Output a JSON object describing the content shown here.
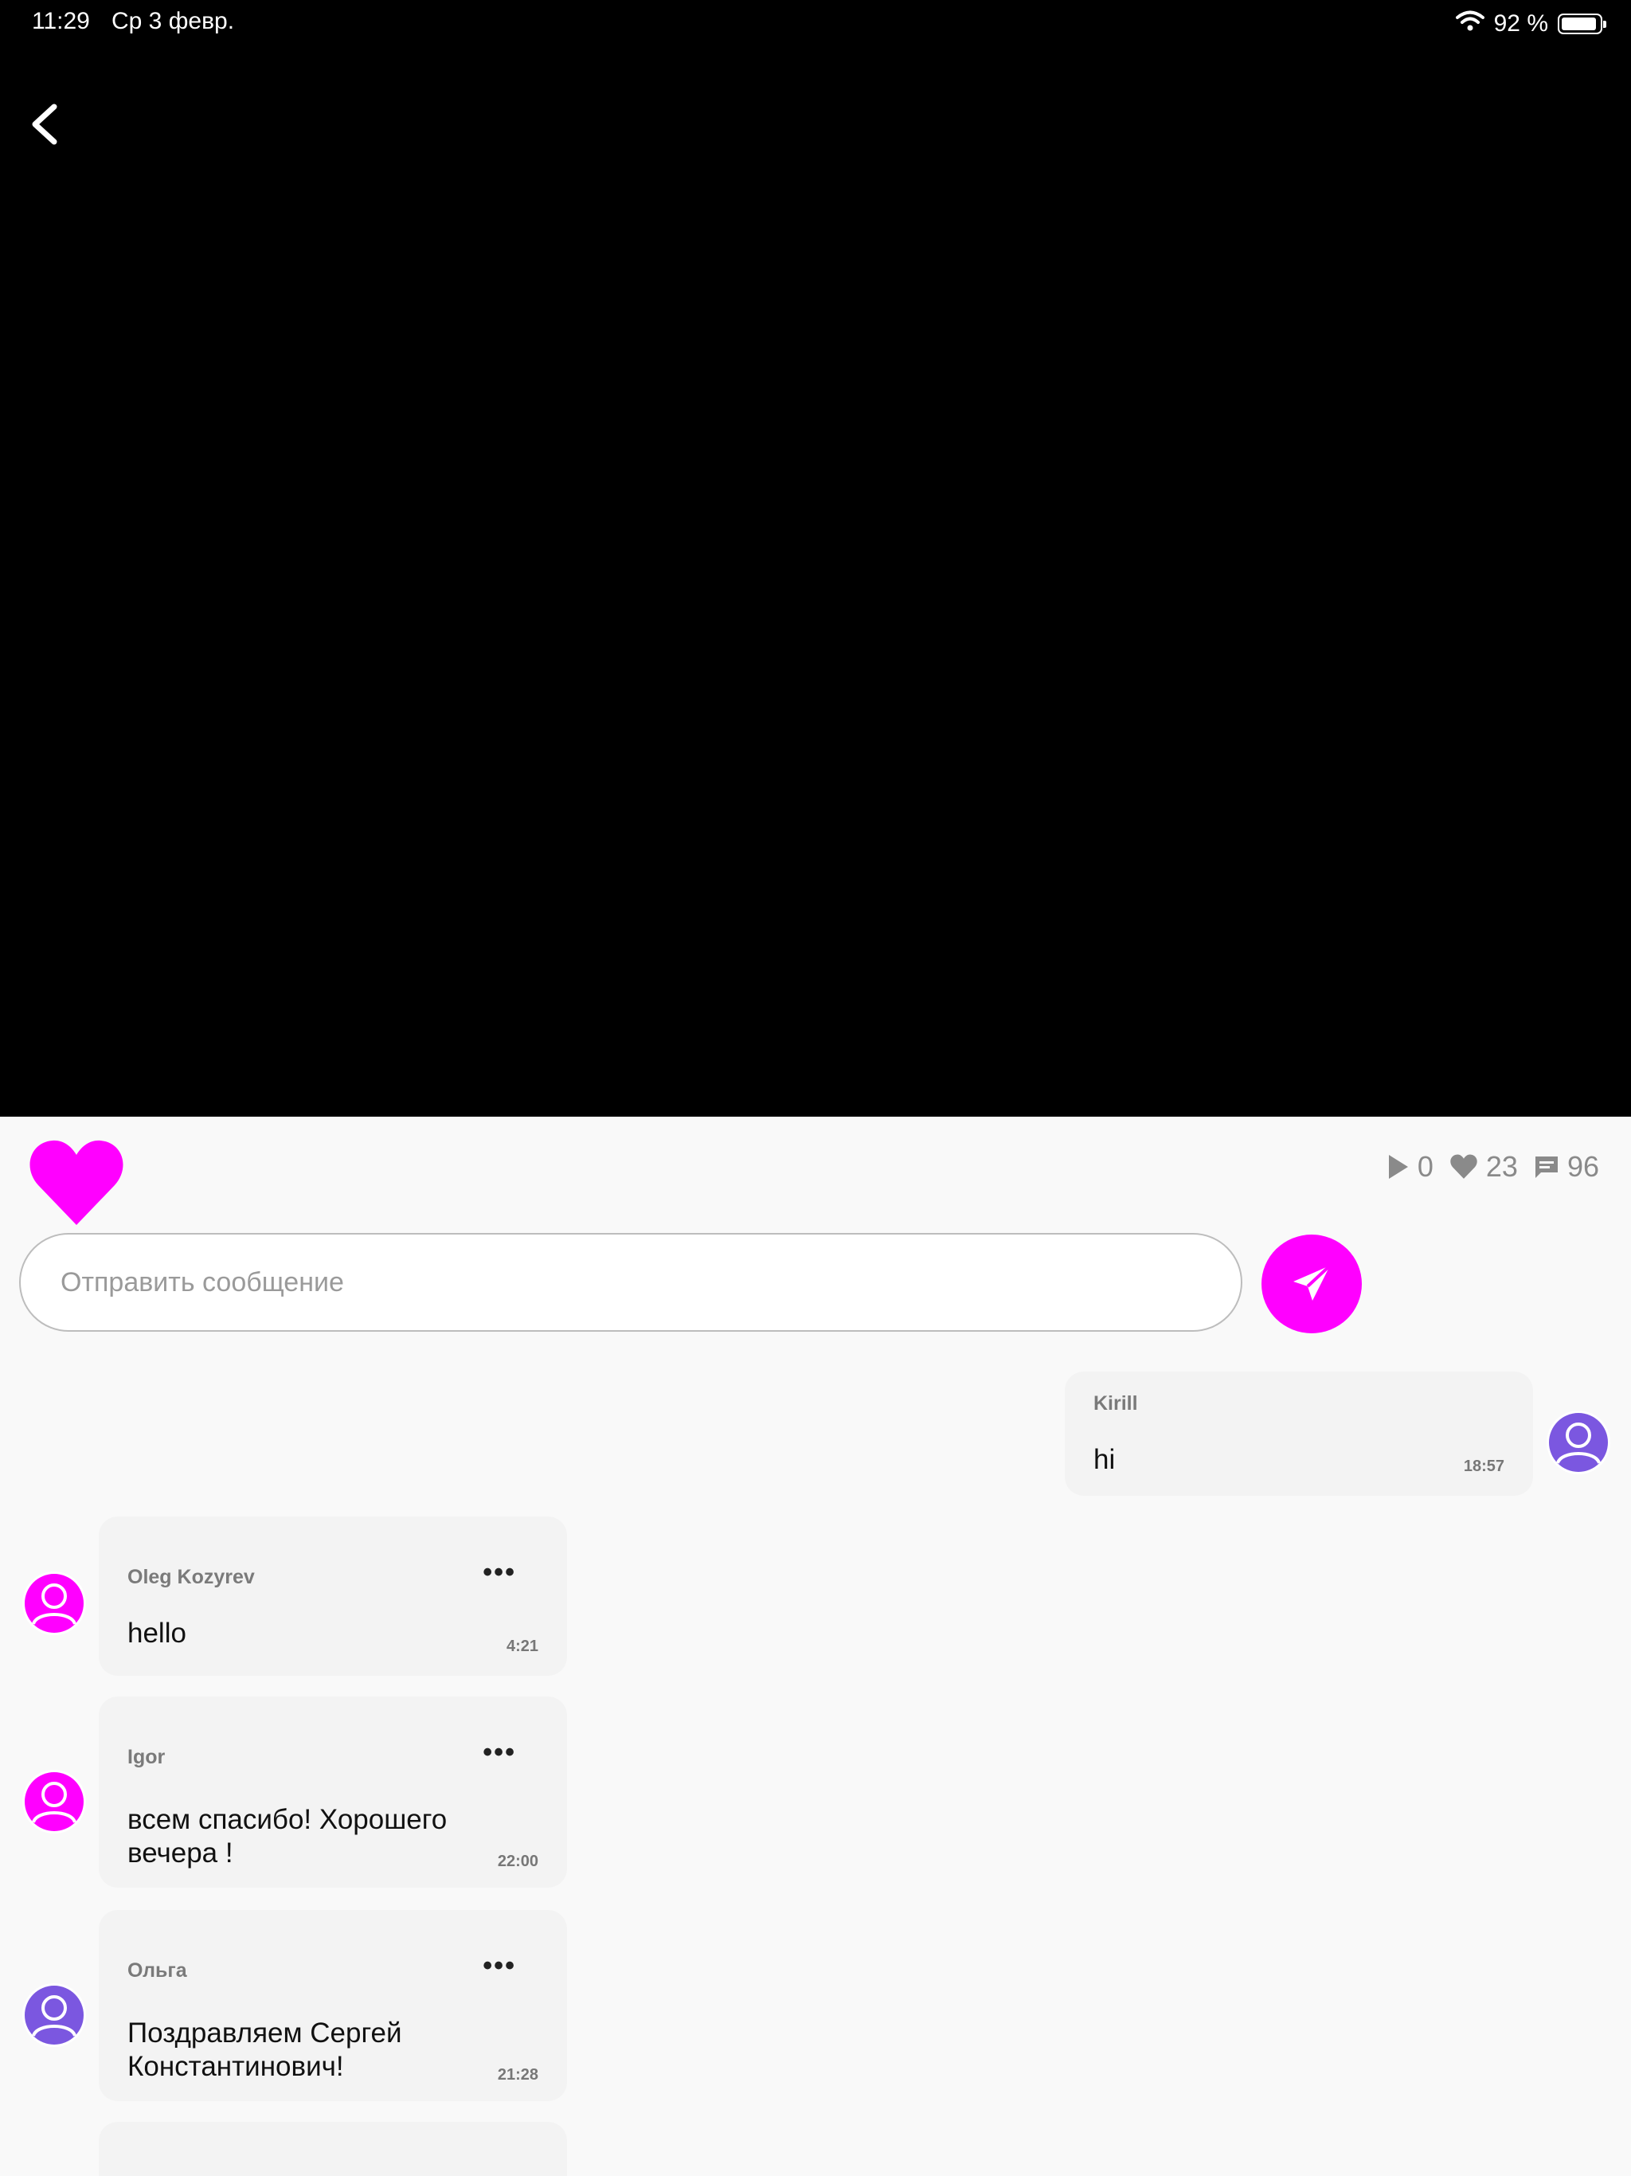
{
  "status_bar": {
    "time": "11:29",
    "date": "Ср 3 февр.",
    "battery": "92 %"
  },
  "stats": {
    "views": "0",
    "likes": "23",
    "comments": "96"
  },
  "composer": {
    "placeholder": "Отправить сообщение"
  },
  "colors": {
    "accent": "#ff00ff",
    "avatar_purple": "#7b57e0"
  },
  "messages": [
    {
      "author": "Kirill",
      "text": "hi",
      "time": "18:57",
      "avatar_color": "#7b57e0"
    },
    {
      "author": "Oleg Kozyrev",
      "text": "hello",
      "time": "4:21",
      "avatar_color": "#ff00ff"
    },
    {
      "author": "Igor",
      "text": "всем спасибо! Хорошего вечера !",
      "time": "22:00",
      "avatar_color": "#ff00ff"
    },
    {
      "author": "Ольга",
      "text": "Поздравляем Сергей Константинович!",
      "time": "21:28",
      "avatar_color": "#7b57e0"
    }
  ],
  "more_label": "•••"
}
